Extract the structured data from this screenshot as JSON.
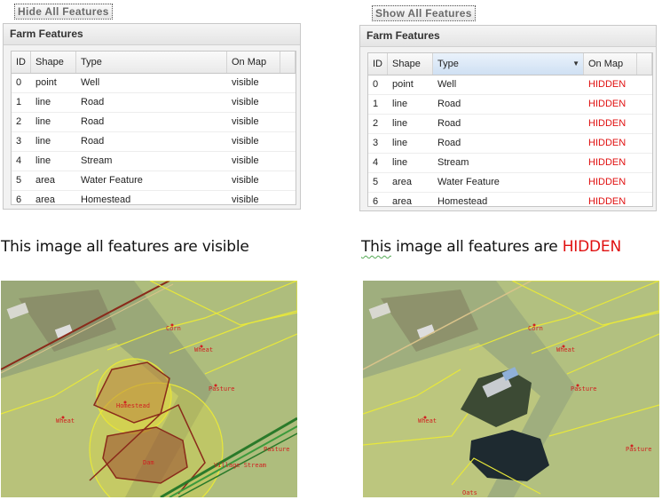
{
  "left": {
    "button_label": "Hide All Features",
    "grid_title": "Farm Features",
    "caption": "This image all features are visible",
    "map_labels": [
      "Corn",
      "Wheat",
      "Pasture",
      "Wheat",
      "Homestead",
      "Dam",
      "Village Stream",
      "Pasture"
    ]
  },
  "right": {
    "button_label": "Show All Features",
    "grid_title": "Farm Features",
    "caption_prefix": "This",
    "caption_middle": " image all features are ",
    "caption_emphasis": "HIDDEN",
    "map_labels": [
      "Corn",
      "Wheat",
      "Pasture",
      "Wheat",
      "Pasture",
      "Oats"
    ]
  },
  "columns": [
    "ID",
    "Shape",
    "Type",
    "On Map"
  ],
  "rows": [
    {
      "id": "0",
      "shape": "point",
      "type": "Well"
    },
    {
      "id": "1",
      "shape": "line",
      "type": "Road"
    },
    {
      "id": "2",
      "shape": "line",
      "type": "Road"
    },
    {
      "id": "3",
      "shape": "line",
      "type": "Road"
    },
    {
      "id": "4",
      "shape": "line",
      "type": "Stream"
    },
    {
      "id": "5",
      "shape": "area",
      "type": "Water Feature"
    },
    {
      "id": "6",
      "shape": "area",
      "type": "Homestead"
    }
  ],
  "status": {
    "visible": "visible",
    "hidden": "HIDDEN"
  },
  "colors": {
    "hidden": "#e01010",
    "field_outline": "#e8e83a",
    "road": "#8a2a1a",
    "stream": "#2a7a2a"
  }
}
